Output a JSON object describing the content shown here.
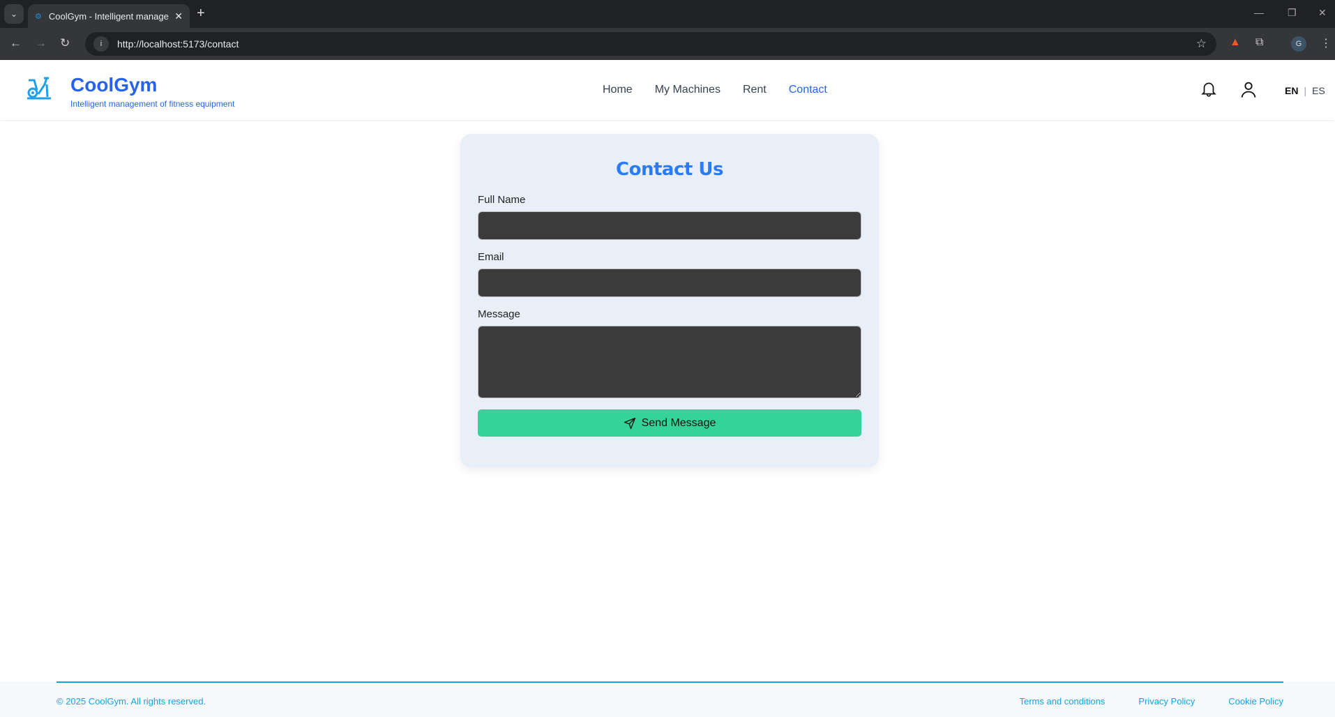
{
  "browser": {
    "tab_title": "CoolGym - Intelligent management of fitness equipment",
    "url": "http://localhost:5173/contact",
    "profile_initial": "G"
  },
  "header": {
    "brand": "CoolGym",
    "tagline": "Intelligent management of fitness equipment",
    "nav": [
      {
        "label": "Home"
      },
      {
        "label": "My Machines"
      },
      {
        "label": "Rent"
      },
      {
        "label": "Contact",
        "active": true
      }
    ],
    "lang_en": "EN",
    "lang_sep": "|",
    "lang_es": "ES"
  },
  "form": {
    "title": "Contact Us",
    "full_name_label": "Full Name",
    "full_name_value": "",
    "email_label": "Email",
    "email_value": "",
    "message_label": "Message",
    "message_value": "",
    "submit_label": "Send Message"
  },
  "footer": {
    "copyright": "© 2025 CoolGym. All rights reserved.",
    "links": [
      {
        "label": "Terms and conditions"
      },
      {
        "label": "Privacy Policy"
      },
      {
        "label": "Cookie Policy"
      }
    ]
  },
  "colors": {
    "brand": "#2563eb",
    "accent": "#34d399",
    "footer_link": "#0ea5e9"
  }
}
